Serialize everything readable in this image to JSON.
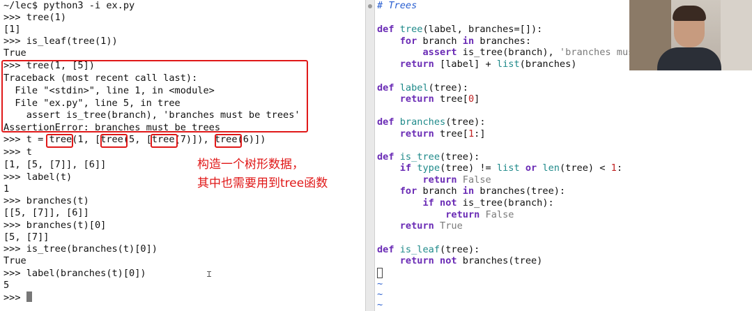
{
  "terminal": {
    "lines": [
      "~/lec$ python3 -i ex.py",
      ">>> tree(1)",
      "[1]",
      ">>> is_leaf(tree(1))",
      "True",
      ">>> tree(1, [5])",
      "Traceback (most recent call last):",
      "  File \"<stdin>\", line 1, in <module>",
      "  File \"ex.py\", line 5, in tree",
      "    assert is_tree(branch), 'branches must be trees'",
      "AssertionError: branches must be trees",
      ">>> t = tree(1, [tree(5, [tree(7)]), tree(6)])",
      ">>> t",
      "[1, [5, [7]], [6]]",
      ">>> label(t)",
      "1",
      ">>> branches(t)",
      "[[5, [7]], [6]]",
      ">>> branches(t)[0]",
      "[5, [7]]",
      ">>> is_tree(branches(t)[0])",
      "True",
      ">>> label(branches(t)[0])",
      "5",
      ">>> "
    ],
    "annotation_text": [
      "构造一个树形数据，",
      "其中也需要用到tree函数"
    ]
  },
  "editor": {
    "code_lines": [
      [
        {
          "t": "# Trees",
          "c": "cm"
        }
      ],
      [],
      [
        {
          "t": "def",
          "c": "kw"
        },
        {
          "t": " "
        },
        {
          "t": "tree",
          "c": "fn"
        },
        {
          "t": "(label, branches=[]):"
        }
      ],
      [
        {
          "t": "    "
        },
        {
          "t": "for",
          "c": "kw"
        },
        {
          "t": " branch "
        },
        {
          "t": "in",
          "c": "kw"
        },
        {
          "t": " branches:"
        }
      ],
      [
        {
          "t": "        "
        },
        {
          "t": "assert",
          "c": "kw"
        },
        {
          "t": " is_tree(branch), "
        },
        {
          "t": "'branches must be trees'",
          "c": "str"
        }
      ],
      [
        {
          "t": "    "
        },
        {
          "t": "return",
          "c": "kw"
        },
        {
          "t": " [label] + "
        },
        {
          "t": "list",
          "c": "fn"
        },
        {
          "t": "(branches)"
        }
      ],
      [],
      [
        {
          "t": "def",
          "c": "kw"
        },
        {
          "t": " "
        },
        {
          "t": "label",
          "c": "fn"
        },
        {
          "t": "(tree):"
        }
      ],
      [
        {
          "t": "    "
        },
        {
          "t": "return",
          "c": "kw"
        },
        {
          "t": " tree["
        },
        {
          "t": "0",
          "c": "num"
        },
        {
          "t": "]"
        }
      ],
      [],
      [
        {
          "t": "def",
          "c": "kw"
        },
        {
          "t": " "
        },
        {
          "t": "branches",
          "c": "fn"
        },
        {
          "t": "(tree):"
        }
      ],
      [
        {
          "t": "    "
        },
        {
          "t": "return",
          "c": "kw"
        },
        {
          "t": " tree["
        },
        {
          "t": "1",
          "c": "num"
        },
        {
          "t": ":]"
        }
      ],
      [],
      [
        {
          "t": "def",
          "c": "kw"
        },
        {
          "t": " "
        },
        {
          "t": "is_tree",
          "c": "fn"
        },
        {
          "t": "(tree):"
        }
      ],
      [
        {
          "t": "    "
        },
        {
          "t": "if",
          "c": "kw"
        },
        {
          "t": " "
        },
        {
          "t": "type",
          "c": "fn"
        },
        {
          "t": "(tree) != "
        },
        {
          "t": "list",
          "c": "fn"
        },
        {
          "t": " "
        },
        {
          "t": "or",
          "c": "kw"
        },
        {
          "t": " "
        },
        {
          "t": "len",
          "c": "fn"
        },
        {
          "t": "(tree) < "
        },
        {
          "t": "1",
          "c": "num"
        },
        {
          "t": ":"
        }
      ],
      [
        {
          "t": "        "
        },
        {
          "t": "return",
          "c": "kw"
        },
        {
          "t": " "
        },
        {
          "t": "False",
          "c": "str"
        }
      ],
      [
        {
          "t": "    "
        },
        {
          "t": "for",
          "c": "kw"
        },
        {
          "t": " branch "
        },
        {
          "t": "in",
          "c": "kw"
        },
        {
          "t": " branches(tree):"
        }
      ],
      [
        {
          "t": "        "
        },
        {
          "t": "if",
          "c": "kw"
        },
        {
          "t": " "
        },
        {
          "t": "not",
          "c": "kw"
        },
        {
          "t": " is_tree(branch):"
        }
      ],
      [
        {
          "t": "            "
        },
        {
          "t": "return",
          "c": "kw"
        },
        {
          "t": " "
        },
        {
          "t": "False",
          "c": "str"
        }
      ],
      [
        {
          "t": "    "
        },
        {
          "t": "return",
          "c": "kw"
        },
        {
          "t": " "
        },
        {
          "t": "True",
          "c": "str"
        }
      ],
      [],
      [
        {
          "t": "def",
          "c": "kw"
        },
        {
          "t": " "
        },
        {
          "t": "is_leaf",
          "c": "fn"
        },
        {
          "t": "(tree):"
        }
      ],
      [
        {
          "t": "    "
        },
        {
          "t": "return",
          "c": "kw"
        },
        {
          "t": " "
        },
        {
          "t": "not",
          "c": "kw"
        },
        {
          "t": " branches(tree)"
        }
      ]
    ],
    "tilde_glyph": "~"
  },
  "colors": {
    "annotation_red": "#e01818",
    "keyword_purple": "#6a2bb5",
    "comment_blue": "#2a5fd0",
    "builtin_teal": "#1f8a8a"
  }
}
